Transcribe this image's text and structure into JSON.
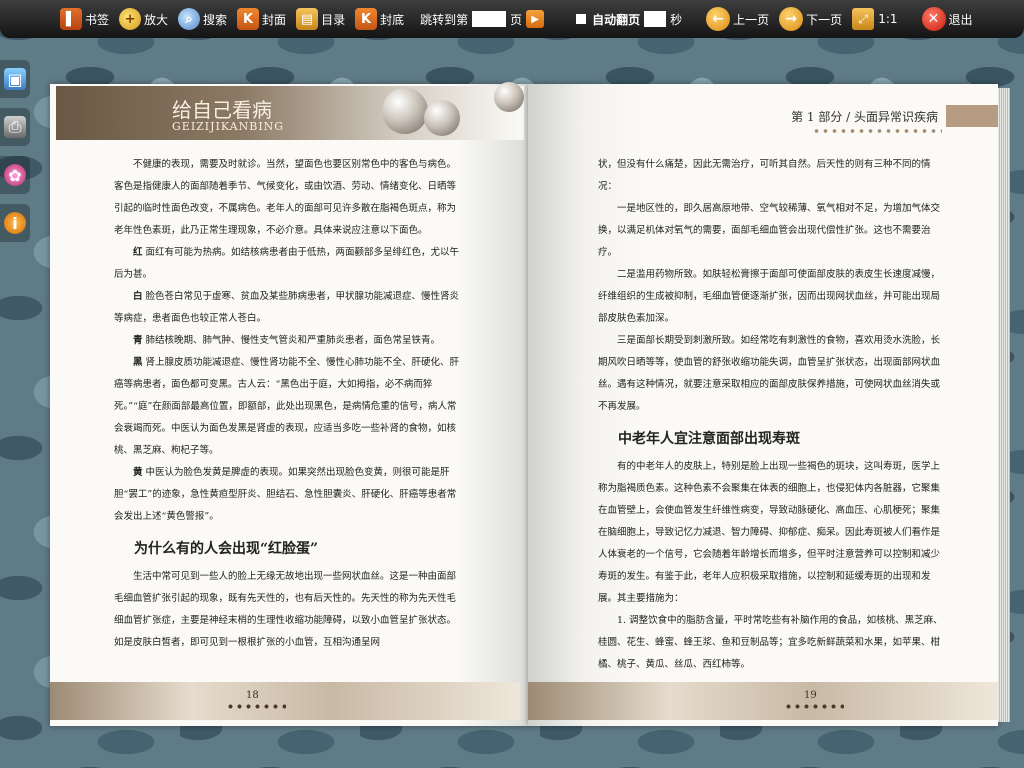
{
  "toolbar": {
    "bookmark": "书签",
    "zoom": "放大",
    "search": "搜索",
    "cover_front": "封面",
    "toc": "目录",
    "cover_back": "封底",
    "jump_prefix": "跳转到第",
    "jump_suffix": "页",
    "auto_flip": "自动翻页",
    "seconds": "秒",
    "prev": "上一页",
    "next": "下一页",
    "ratio": "1:1",
    "exit": "退出"
  },
  "left_page": {
    "header_title": "给自己看病",
    "header_subtitle": "GEIZIJIKANBING",
    "paragraphs": [
      {
        "lead": "",
        "text": "不健康的表现，需要及时就诊。当然，望面色也要区别常色中的客色与病色。客色是指健康人的面部随着季节、气候变化，或由饮酒、劳动、情绪变化、日晒等引起的临时性面色改变，不属病色。老年人的面部可见许多散在脂褐色斑点，称为老年性色素斑，此乃正常生理现象，不必介意。具体来说应注意以下面色。"
      },
      {
        "lead": "红",
        "text": " 面红有可能为热病。如结核病患者由于低热，两面颧部多呈绯红色，尤以午后为甚。"
      },
      {
        "lead": "白",
        "text": " 脸色苍白常见于虚寒、贫血及某些肺病患者，甲状腺功能减退症、慢性肾炎等病症，患者面色也较正常人苍白。"
      },
      {
        "lead": "青",
        "text": " 肺结核晚期、肺气肿、慢性支气管炎和严重肺炎患者，面色常呈铁青。"
      },
      {
        "lead": "黑",
        "text": " 肾上腺皮质功能减退症、慢性肾功能不全、慢性心肺功能不全、肝硬化、肝癌等病患者，面色都可变黑。古人云：“黑色出于庭，大如拇指，必不病而猝死。”“庭”在颜面部最高位置，即额部，此处出现黑色，是病情危重的信号，病人常会衰竭而死。中医认为面色发黑是肾虚的表现，应适当多吃一些补肾的食物，如核桃、黑芝麻、枸杞子等。"
      },
      {
        "lead": "黄",
        "text": " 中医认为脸色发黄是脾虚的表现。如果突然出现脸色变黄，则很可能是肝胆“罢工”的迹象，急性黄疸型肝炎、胆结石、急性胆囊炎、肝硬化、肝癌等患者常会发出上述“黄色警报”。"
      }
    ],
    "section_title": "为什么有的人会出现“红脸蛋”",
    "section_text": "生活中常可见到一些人的脸上无缘无故地出现一些网状血丝。这是一种由面部毛细血管扩张引起的现象，既有先天性的，也有后天性的。先天性的称为先天性毛细血管扩张症，主要是神经末梢的生理性收缩功能障碍，以致小血管呈扩张状态。如是皮肤白皙者，即可见到一根根扩张的小血管，互相沟通呈网",
    "page_number": "18"
  },
  "right_page": {
    "header_text": "第 1 部分 / 头面异常识疾病",
    "paragraphs": [
      {
        "indent": false,
        "text": "状，但没有什么痛楚，因此无需治疗，可听其自然。后天性的则有三种不同的情况："
      },
      {
        "indent": true,
        "text": "一是地区性的，即久居高原地带、空气较稀薄、氧气相对不足，为增加气体交换，以满足机体对氧气的需要，面部毛细血管会出现代偿性扩张。这也不需要治疗。"
      },
      {
        "indent": true,
        "text": "二是滥用药物所致。如肤轻松膏擦于面部可使面部皮肤的表皮生长速度减慢，纤维组织的生成被抑制，毛细血管便逐渐扩张，因而出现网状血丝，并可能出现局部皮肤色素加深。"
      },
      {
        "indent": true,
        "text": "三是面部长期受到刺激所致。如经常吃有刺激性的食物，喜欢用烫水洗脸，长期风吹日晒等等，使血管的舒张收缩功能失调，血管呈扩张状态，出现面部网状血丝。遇有这种情况，就要注意采取相应的面部皮肤保养措施，可使网状血丝消失或不再发展。"
      }
    ],
    "section_title": "中老年人宜注意面部出现寿斑",
    "section_paragraphs": [
      {
        "indent": true,
        "text": "有的中老年人的皮肤上，特别是脸上出现一些褐色的斑块，这叫寿斑，医学上称为脂褐质色素。这种色素不会聚集在体表的细胞上，也侵犯体内各脏器，它聚集在血管壁上，会使血管发生纤维性病变，导致动脉硬化、高血压、心肌梗死；聚集在脑细胞上，导致记忆力减退、智力障碍、抑郁症、痴呆。因此寿斑被人们看作是人体衰老的一个信号，它会随着年龄增长而增多，但平时注意营养可以控制和减少寿斑的发生。有鉴于此，老年人应积极采取措施，以控制和延缓寿斑的出现和发展。其主要措施为："
      },
      {
        "indent": true,
        "text": "1. 调整饮食中的脂肪含量，平时常吃些有补脑作用的食品，如核桃、黑芝麻、桂圆、花生、蜂蜜、蜂王浆、鱼和豆制品等；宜多吃新鲜蔬菜和水果，如苹果、柑橘、桃子、黄瓜、丝瓜、西红柿等。"
      }
    ],
    "page_number": "19"
  }
}
